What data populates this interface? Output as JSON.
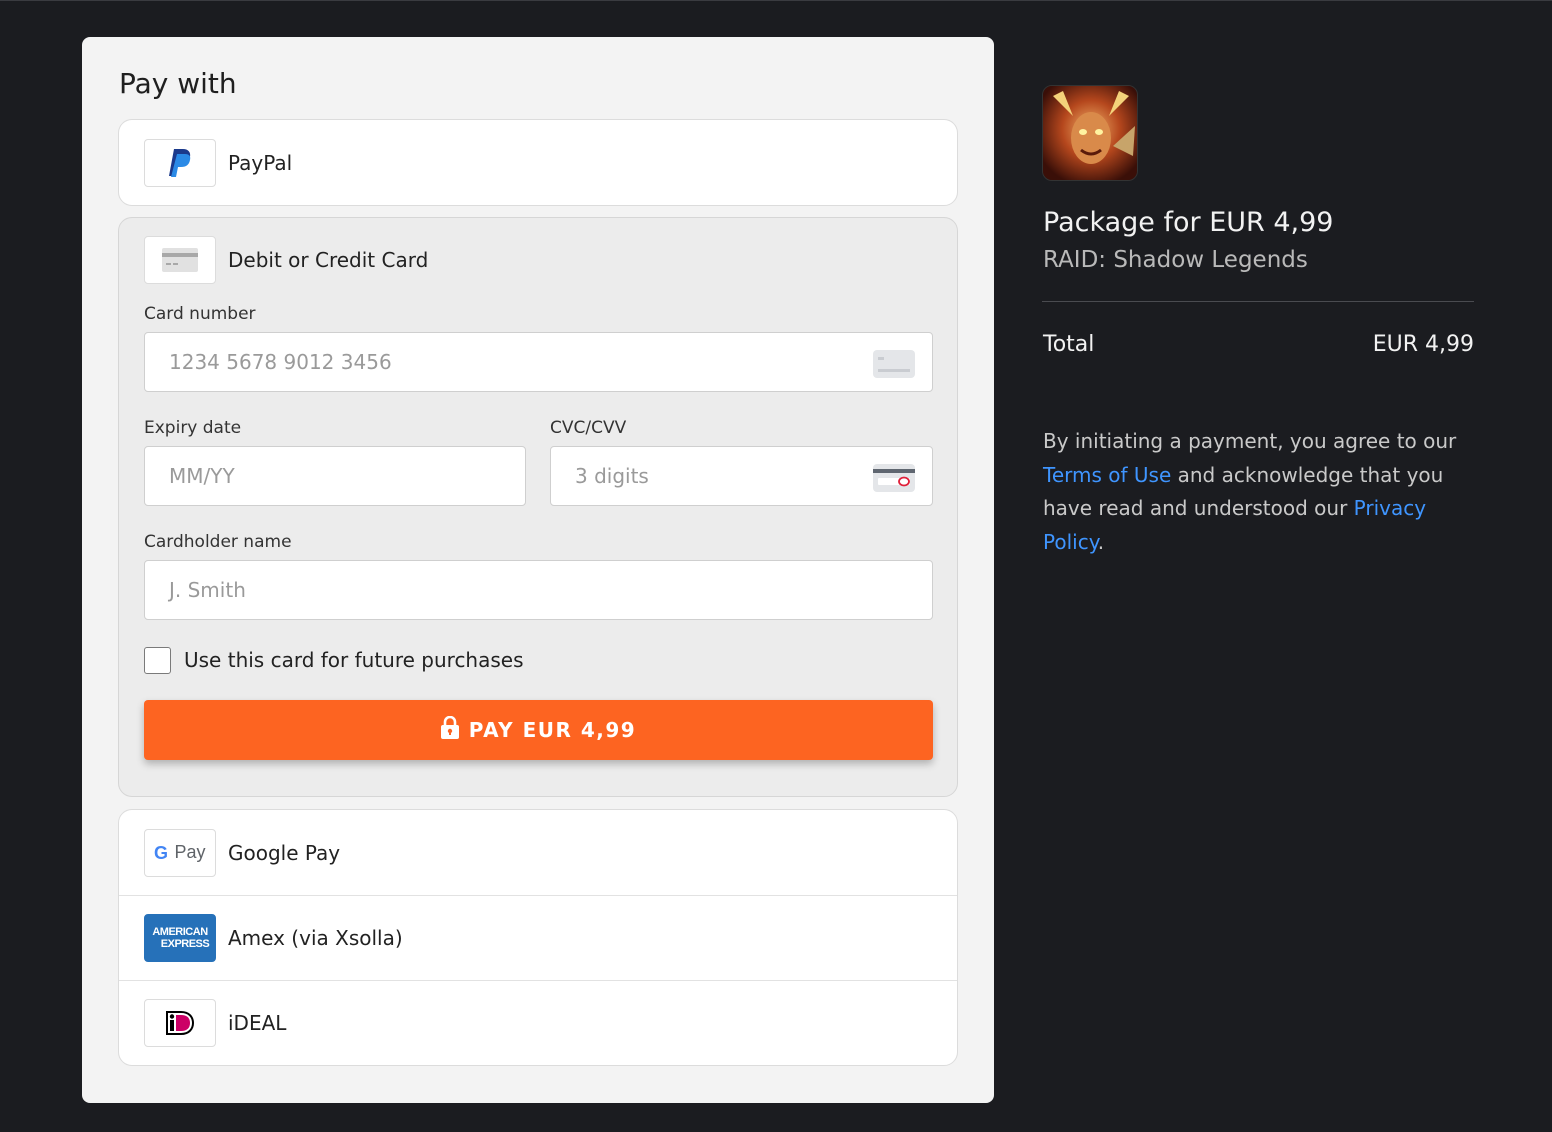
{
  "payment_panel": {
    "title": "Pay with",
    "paypal": {
      "label": "PayPal"
    },
    "card": {
      "label": "Debit or Credit Card",
      "card_number_label": "Card number",
      "card_number_placeholder": "1234 5678 9012 3456",
      "expiry_label": "Expiry date",
      "expiry_placeholder": "MM/YY",
      "cvc_label": "CVC/CVV",
      "cvc_placeholder": "3 digits",
      "holder_label": "Cardholder name",
      "holder_placeholder": "J. Smith",
      "save_card_label": "Use this card for future purchases",
      "save_card_checked": false,
      "pay_button_label": "PAY EUR 4,99"
    },
    "other_methods": [
      {
        "label": "Google Pay",
        "logo": "google-pay-logo",
        "logo_text": "Pay"
      },
      {
        "label": "Amex (via Xsolla)",
        "logo": "amex-logo",
        "logo_text_1": "AMERICAN",
        "logo_text_2": "EXPRESS"
      },
      {
        "label": "iDEAL",
        "logo": "ideal-logo"
      }
    ]
  },
  "summary": {
    "game_icon": "raid-shadow-legends-icon",
    "package_title": "Package for EUR 4,99",
    "game_name": "RAID: Shadow Legends",
    "total_label": "Total",
    "total_value": "EUR 4,99",
    "legal": {
      "part1": "By initiating a payment, you agree to our ",
      "terms_link": "Terms of Use",
      "part2": " and acknowledge that you have read and understood our ",
      "privacy_link": "Privacy Policy",
      "part3": "."
    }
  },
  "colors": {
    "background": "#1b1c20",
    "panel": "#f3f3f3",
    "accent": "#fd6421",
    "link": "#3f95ff"
  }
}
